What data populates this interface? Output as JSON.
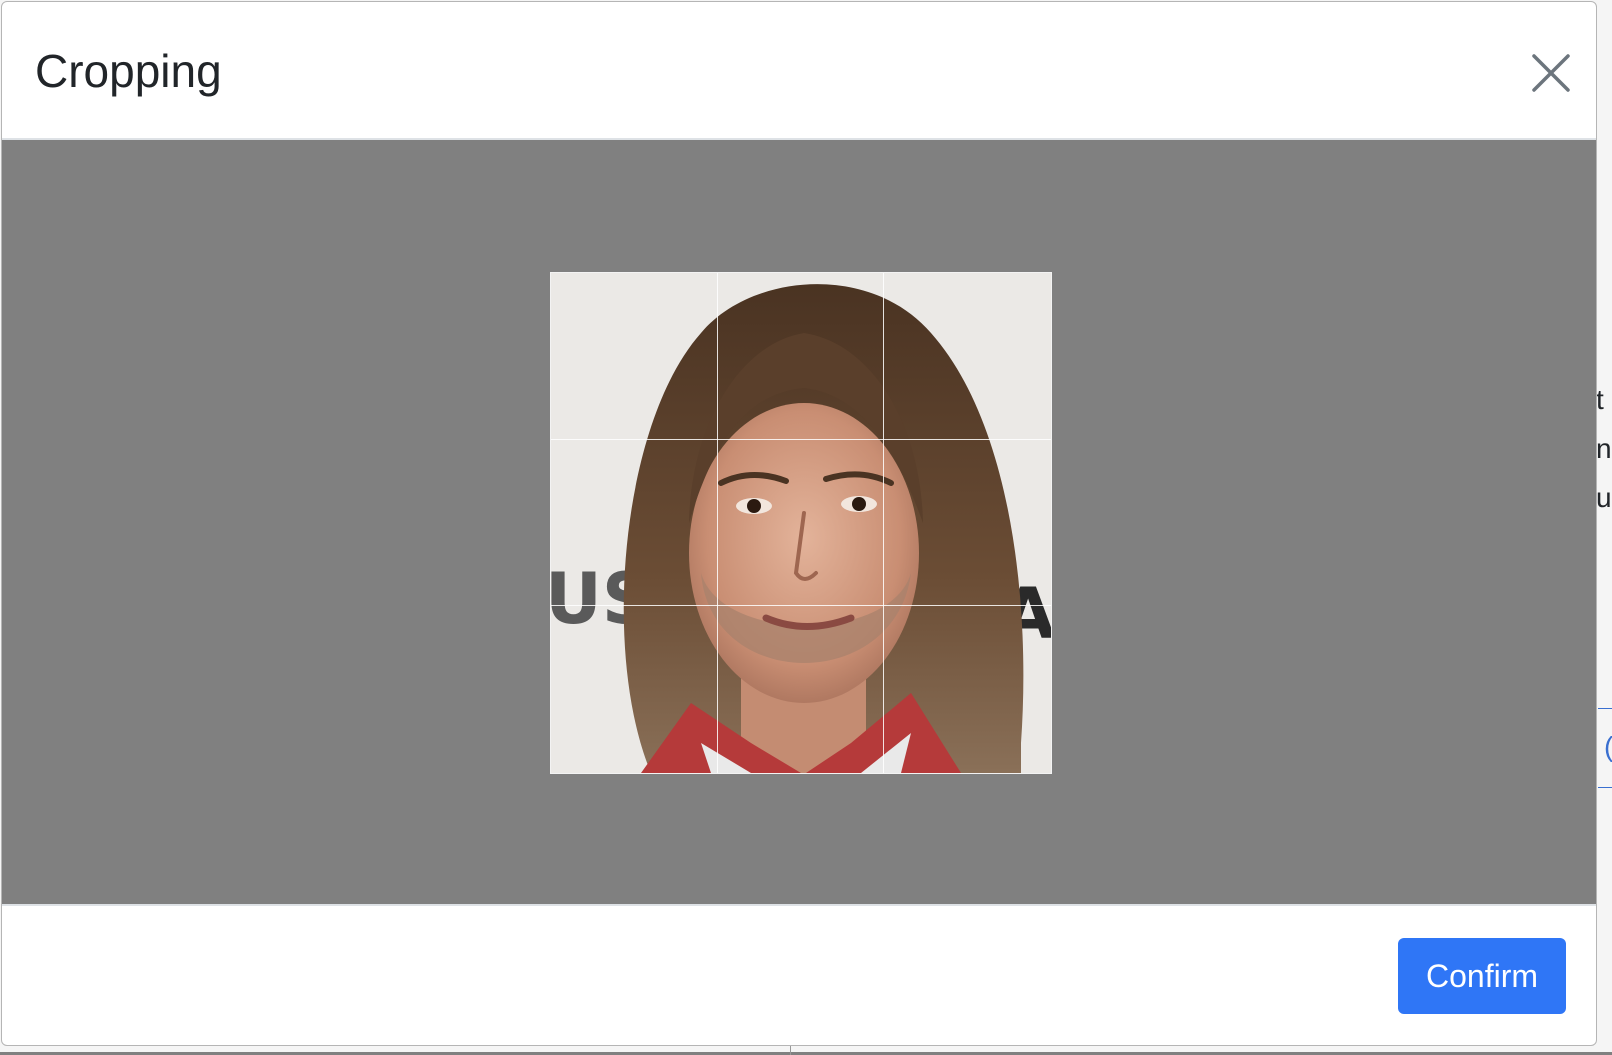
{
  "modal": {
    "title": "Cropping",
    "close_icon": "close-x-icon",
    "confirm_label": "Confirm"
  },
  "background_fragments": {
    "line1": "t",
    "line2": "n",
    "line3": "u",
    "link_char": "("
  },
  "colors": {
    "overlay": "#808080",
    "primary_button": "#2f76f6",
    "title_text": "#212529",
    "close_icon": "#6c757d"
  },
  "crop": {
    "aspect": "1:1",
    "grid": "3x3"
  }
}
